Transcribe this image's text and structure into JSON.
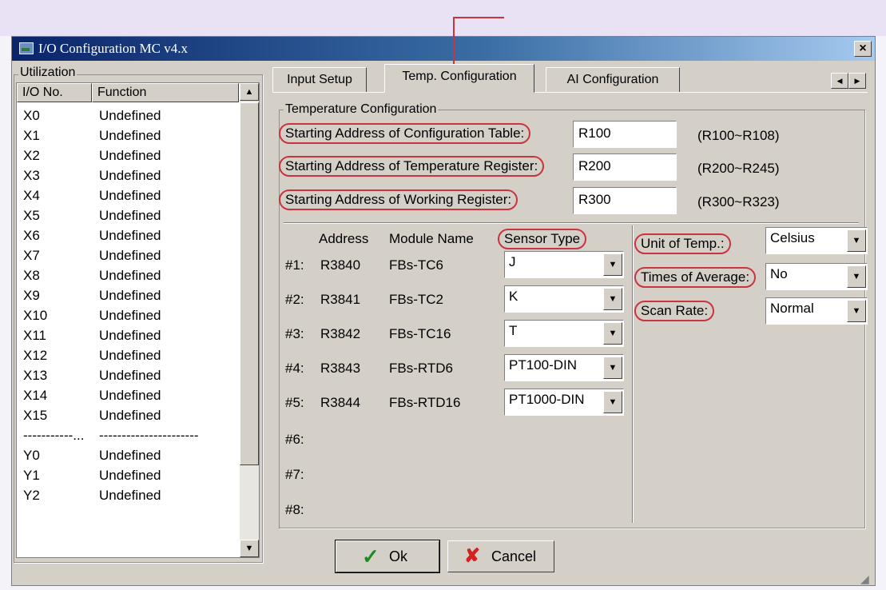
{
  "window": {
    "title": "I/O Configuration MC v4.x",
    "close_glyph": "×"
  },
  "utilization": {
    "group_label": "Utilization",
    "columns": [
      "I/O No.",
      "Function"
    ],
    "rows": [
      {
        "no": "X0",
        "fn": "Undefined"
      },
      {
        "no": "X1",
        "fn": "Undefined"
      },
      {
        "no": "X2",
        "fn": "Undefined"
      },
      {
        "no": "X3",
        "fn": "Undefined"
      },
      {
        "no": "X4",
        "fn": "Undefined"
      },
      {
        "no": "X5",
        "fn": "Undefined"
      },
      {
        "no": "X6",
        "fn": "Undefined"
      },
      {
        "no": "X7",
        "fn": "Undefined"
      },
      {
        "no": "X8",
        "fn": "Undefined"
      },
      {
        "no": "X9",
        "fn": "Undefined"
      },
      {
        "no": "X10",
        "fn": "Undefined"
      },
      {
        "no": "X11",
        "fn": "Undefined"
      },
      {
        "no": "X12",
        "fn": "Undefined"
      },
      {
        "no": "X13",
        "fn": "Undefined"
      },
      {
        "no": "X14",
        "fn": "Undefined"
      },
      {
        "no": "X15",
        "fn": "Undefined"
      },
      {
        "no": "-----------...",
        "fn": "----------------------"
      },
      {
        "no": "Y0",
        "fn": "Undefined"
      },
      {
        "no": "Y1",
        "fn": "Undefined"
      },
      {
        "no": "Y2",
        "fn": "Undefined"
      }
    ]
  },
  "tabs": [
    {
      "label": "Input Setup",
      "active": false
    },
    {
      "label": "Temp. Configuration",
      "active": true
    },
    {
      "label": "AI Configuration",
      "active": false
    }
  ],
  "temp_config": {
    "group_label": "Temperature Configuration",
    "fields": [
      {
        "label": "Starting Address of Configuration Table:",
        "value": "R100",
        "range": "(R100~R108)"
      },
      {
        "label": "Starting Address of Temperature Register:",
        "value": "R200",
        "range": "(R200~R245)"
      },
      {
        "label": "Starting Address of Working Register:",
        "value": "R300",
        "range": "(R300~R323)"
      }
    ],
    "module_headers": {
      "address": "Address",
      "module_name": "Module Name",
      "sensor_type": "Sensor Type"
    },
    "modules": [
      {
        "slot": "#1:",
        "address": "R3840",
        "name": "FBs-TC6",
        "sensor": "J"
      },
      {
        "slot": "#2:",
        "address": "R3841",
        "name": "FBs-TC2",
        "sensor": "K"
      },
      {
        "slot": "#3:",
        "address": "R3842",
        "name": "FBs-TC16",
        "sensor": "T"
      },
      {
        "slot": "#4:",
        "address": "R3843",
        "name": "FBs-RTD6",
        "sensor": "PT100-DIN"
      },
      {
        "slot": "#5:",
        "address": "R3844",
        "name": "FBs-RTD16",
        "sensor": "PT1000-DIN"
      },
      {
        "slot": "#6:",
        "address": "",
        "name": "",
        "sensor": ""
      },
      {
        "slot": "#7:",
        "address": "",
        "name": "",
        "sensor": ""
      },
      {
        "slot": "#8:",
        "address": "",
        "name": "",
        "sensor": ""
      }
    ],
    "options": [
      {
        "label": "Unit of Temp.:",
        "value": "Celsius"
      },
      {
        "label": "Times of Average:",
        "value": "No"
      },
      {
        "label": "Scan Rate:",
        "value": "Normal"
      }
    ]
  },
  "buttons": {
    "ok": "Ok",
    "cancel": "Cancel"
  },
  "colors": {
    "annotation": "#c9343e",
    "title_bar_start": "#0a246a",
    "dialog_face": "#d4d0c8"
  }
}
